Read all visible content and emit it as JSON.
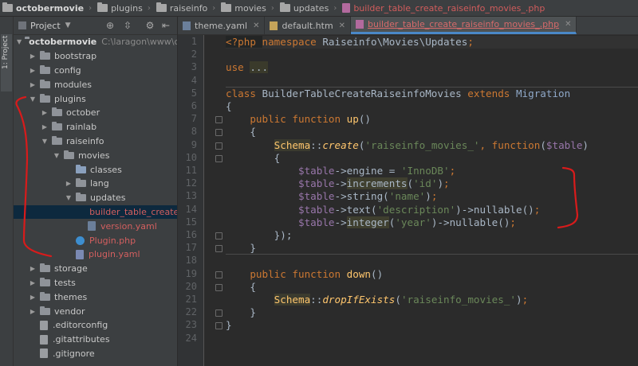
{
  "breadcrumb": [
    {
      "label": "octobermovie",
      "kind": "root"
    },
    {
      "label": "plugins",
      "kind": "folder"
    },
    {
      "label": "raiseinfo",
      "kind": "folder"
    },
    {
      "label": "movies",
      "kind": "folder"
    },
    {
      "label": "updates",
      "kind": "folder"
    },
    {
      "label": "builder_table_create_raiseinfo_movies_.php",
      "kind": "file"
    }
  ],
  "side_tab": "1: Project",
  "project_panel": {
    "title": "Project",
    "tools": [
      "settings-target-icon",
      "collapse-icon",
      "gear-icon",
      "hide-icon"
    ]
  },
  "tree": [
    {
      "label": "octobermovie",
      "depth": 0,
      "open": true,
      "icon": "folder",
      "bold": true,
      "path": "C:\\laragon\\www\\oc"
    },
    {
      "label": "bootstrap",
      "depth": 1,
      "open": false,
      "icon": "folder"
    },
    {
      "label": "config",
      "depth": 1,
      "open": false,
      "icon": "folder"
    },
    {
      "label": "modules",
      "depth": 1,
      "open": false,
      "icon": "folder"
    },
    {
      "label": "plugins",
      "depth": 1,
      "open": true,
      "icon": "folder"
    },
    {
      "label": "october",
      "depth": 2,
      "open": false,
      "icon": "folder"
    },
    {
      "label": "rainlab",
      "depth": 2,
      "open": false,
      "icon": "folder"
    },
    {
      "label": "raiseinfo",
      "depth": 2,
      "open": true,
      "icon": "folder"
    },
    {
      "label": "movies",
      "depth": 3,
      "open": true,
      "icon": "folder"
    },
    {
      "label": "classes",
      "depth": 4,
      "leaf": true,
      "icon": "folder"
    },
    {
      "label": "lang",
      "depth": 4,
      "open": false,
      "icon": "folder"
    },
    {
      "label": "updates",
      "depth": 4,
      "open": true,
      "icon": "folder"
    },
    {
      "label": "builder_table_create",
      "depth": 5,
      "leaf": true,
      "icon": "ytable",
      "red": true,
      "selected": true
    },
    {
      "label": "version.yaml",
      "depth": 5,
      "leaf": true,
      "icon": "yaml",
      "red": true
    },
    {
      "label": "Plugin.php",
      "depth": 4,
      "leaf": true,
      "icon": "php-c",
      "red": true
    },
    {
      "label": "plugin.yaml",
      "depth": 4,
      "leaf": true,
      "icon": "ytable",
      "red": true
    },
    {
      "label": "storage",
      "depth": 1,
      "open": false,
      "icon": "folder"
    },
    {
      "label": "tests",
      "depth": 1,
      "open": false,
      "icon": "folder"
    },
    {
      "label": "themes",
      "depth": 1,
      "open": false,
      "icon": "folder"
    },
    {
      "label": "vendor",
      "depth": 1,
      "open": false,
      "icon": "folder"
    },
    {
      "label": ".editorconfig",
      "depth": 1,
      "leaf": true,
      "icon": "doc"
    },
    {
      "label": ".gitattributes",
      "depth": 1,
      "leaf": true,
      "icon": "doc"
    },
    {
      "label": ".gitignore",
      "depth": 1,
      "leaf": true,
      "icon": "doc"
    }
  ],
  "tabs": [
    {
      "label": "theme.yaml",
      "icon": "yaml",
      "active": false
    },
    {
      "label": "default.htm",
      "icon": "htm",
      "active": false
    },
    {
      "label": "builder_table_create_raiseinfo_movies_.php",
      "icon": "php",
      "active": true
    }
  ],
  "editor": {
    "current_line": 1,
    "lines": [
      [
        [
          "php-tag",
          "<?php "
        ],
        [
          "kw",
          "namespace "
        ],
        [
          "ns",
          "Raiseinfo\\Movies\\Updates"
        ],
        [
          "kw",
          ";"
        ]
      ],
      [],
      [
        [
          "kw",
          "use "
        ],
        [
          "dots",
          "..."
        ]
      ],
      [],
      [
        [
          "kw",
          "class "
        ],
        [
          "cls",
          "BuilderTableCreateRaiseinfoMovies "
        ],
        [
          "kw",
          "extends "
        ],
        [
          "mig",
          "Migration"
        ]
      ],
      [
        [
          "cls",
          "{"
        ]
      ],
      [
        [
          "cls",
          "    "
        ],
        [
          "kw",
          "public function "
        ],
        [
          "fn",
          "up"
        ],
        [
          "cls",
          "()"
        ]
      ],
      [
        [
          "cls",
          "    {"
        ]
      ],
      [
        [
          "cls",
          "        "
        ],
        [
          "schema",
          "Schema"
        ],
        [
          "cls",
          "::"
        ],
        [
          "ital",
          "create"
        ],
        [
          "cls",
          "("
        ],
        [
          "str",
          "'raiseinfo_movies_'"
        ],
        [
          "kw",
          ", function"
        ],
        [
          "cls",
          "("
        ],
        [
          "var",
          "$table"
        ],
        [
          "cls",
          ")"
        ]
      ],
      [
        [
          "cls",
          "        {"
        ]
      ],
      [
        [
          "cls",
          "            "
        ],
        [
          "var",
          "$table"
        ],
        [
          "cls",
          "->"
        ],
        [
          "cls",
          "engine = "
        ],
        [
          "str",
          "'InnoDB'"
        ],
        [
          "kw",
          ";"
        ]
      ],
      [
        [
          "cls",
          "            "
        ],
        [
          "var",
          "$table"
        ],
        [
          "cls",
          "->"
        ],
        [
          "meth",
          "increments"
        ],
        [
          "cls",
          "("
        ],
        [
          "str",
          "'id'"
        ],
        [
          "cls",
          ")"
        ],
        [
          "kw",
          ";"
        ]
      ],
      [
        [
          "cls",
          "            "
        ],
        [
          "var",
          "$table"
        ],
        [
          "cls",
          "->"
        ],
        [
          "cls",
          "string("
        ],
        [
          "str",
          "'name'"
        ],
        [
          "cls",
          ")"
        ],
        [
          "kw",
          ";"
        ]
      ],
      [
        [
          "cls",
          "            "
        ],
        [
          "var",
          "$table"
        ],
        [
          "cls",
          "->"
        ],
        [
          "cls",
          "text("
        ],
        [
          "str",
          "'description'"
        ],
        [
          "cls",
          ")->nullable()"
        ],
        [
          "kw",
          ";"
        ]
      ],
      [
        [
          "cls",
          "            "
        ],
        [
          "var",
          "$table"
        ],
        [
          "cls",
          "->"
        ],
        [
          "meth",
          "integer"
        ],
        [
          "cls",
          "("
        ],
        [
          "str",
          "'year'"
        ],
        [
          "cls",
          ")->nullable()"
        ],
        [
          "kw",
          ";"
        ]
      ],
      [
        [
          "cls",
          "        });"
        ]
      ],
      [
        [
          "cls",
          "    }"
        ]
      ],
      [],
      [
        [
          "cls",
          "    "
        ],
        [
          "kw",
          "public function "
        ],
        [
          "fn",
          "down"
        ],
        [
          "cls",
          "()"
        ]
      ],
      [
        [
          "cls",
          "    {"
        ]
      ],
      [
        [
          "cls",
          "        "
        ],
        [
          "schema",
          "Schema"
        ],
        [
          "cls",
          "::"
        ],
        [
          "ital",
          "dropIfExists"
        ],
        [
          "cls",
          "("
        ],
        [
          "str",
          "'raiseinfo_movies_'"
        ],
        [
          "cls",
          ")"
        ],
        [
          "kw",
          ";"
        ]
      ],
      [
        [
          "cls",
          "    }"
        ]
      ],
      [
        [
          "cls",
          "}"
        ]
      ],
      []
    ]
  },
  "colors": {
    "background": "#2b2b2b",
    "panel": "#3c3f41",
    "selection": "#0d293e",
    "keyword": "#cc7832",
    "string": "#6a8759",
    "variable": "#9876aa",
    "function": "#ffc66d",
    "annotation": "#d81b1b"
  }
}
